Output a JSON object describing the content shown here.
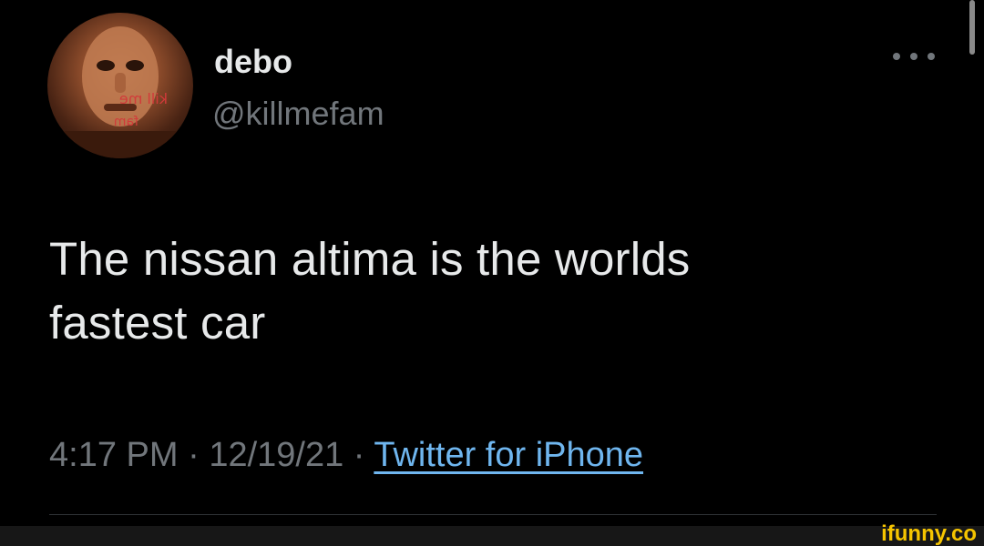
{
  "tweet": {
    "display_name": "debo",
    "handle": "@killmefam",
    "text_line1": "The nissan altima is the worlds",
    "text_line2": "fastest car",
    "time": "4:17 PM",
    "separator": "·",
    "date": "12/19/21",
    "source": "Twitter for iPhone"
  },
  "avatar": {
    "overlay_text_1": "kill me",
    "overlay_text_2": "fam"
  },
  "watermark": {
    "text": "ifunny.co"
  },
  "colors": {
    "background": "#000000",
    "primary_text": "#e7e9ea",
    "secondary_text": "#71767b",
    "link": "#6fb6ef",
    "watermark": "#f5c400"
  },
  "icons": {
    "more": "more-horizontal-icon"
  }
}
